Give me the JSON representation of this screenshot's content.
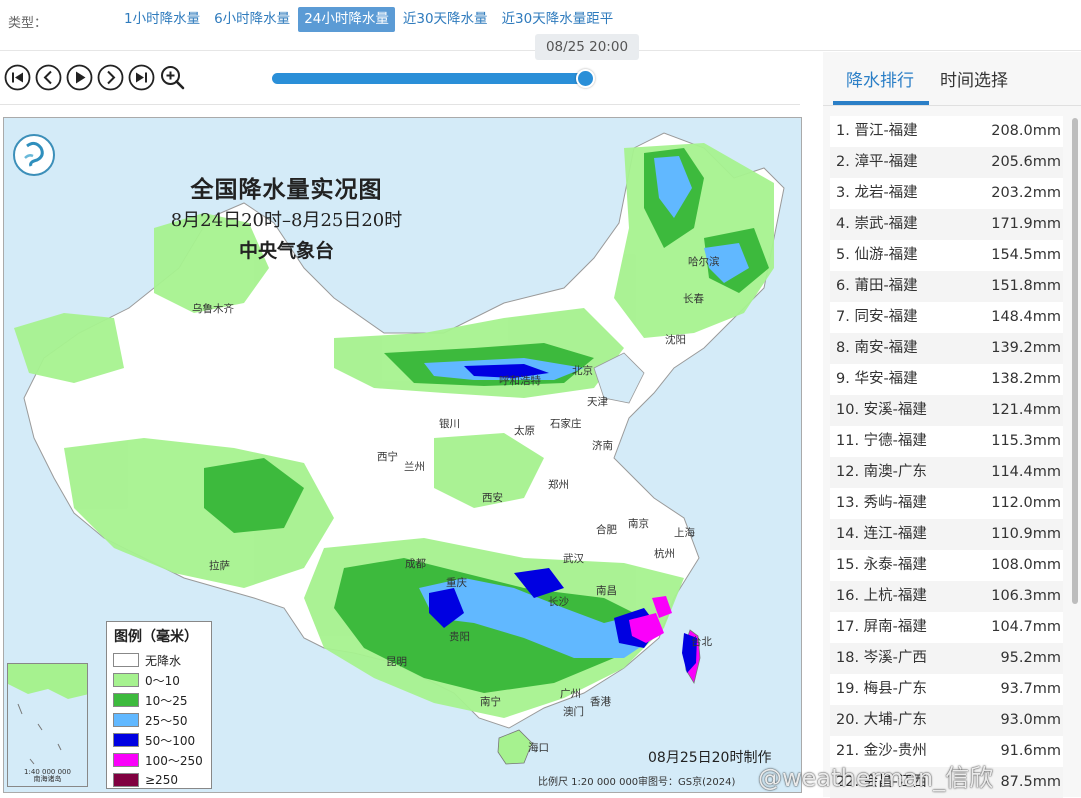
{
  "type_bar": {
    "label": "类型：",
    "tabs": [
      {
        "label": "1小时降水量",
        "active": false
      },
      {
        "label": "6小时降水量",
        "active": false
      },
      {
        "label": "24小时降水量",
        "active": true
      },
      {
        "label": "近30天降水量",
        "active": false
      },
      {
        "label": "近30天降水量距平",
        "active": false
      }
    ]
  },
  "player": {
    "controls": [
      "first-frame-icon",
      "prev-frame-icon",
      "play-icon",
      "next-frame-icon",
      "last-frame-icon",
      "zoom-in-icon"
    ],
    "current_time": "08/25 20:00",
    "progress": 1.0
  },
  "map": {
    "title": "全国降水量实况图",
    "period": "8月24日20时–8月25日20时",
    "agency": "中央气象台",
    "made_by": "08月25日20时制作",
    "scale": "比例尺 1:20 000 000",
    "review_no": "审图号：GS京(2024)",
    "legend": {
      "title": "图例（毫米）",
      "items": [
        {
          "label": "无降水",
          "color": "#ffffff"
        },
        {
          "label": "0～10",
          "color": "#a6f28f"
        },
        {
          "label": "10～25",
          "color": "#3dba3d"
        },
        {
          "label": "25～50",
          "color": "#61b8ff"
        },
        {
          "label": "50～100",
          "color": "#0000e1"
        },
        {
          "label": "100～250",
          "color": "#fa00fa"
        },
        {
          "label": "≥250",
          "color": "#800040"
        }
      ]
    },
    "inset": {
      "scale": "1:40 000 000",
      "caption": "南海诸岛"
    },
    "cities": [
      {
        "name": "哈尔滨"
      },
      {
        "name": "长春"
      },
      {
        "name": "乌鲁木齐"
      },
      {
        "name": "沈阳"
      },
      {
        "name": "呼和浩特"
      },
      {
        "name": "北京"
      },
      {
        "name": "天津"
      },
      {
        "name": "石家庄"
      },
      {
        "name": "银川"
      },
      {
        "name": "太原"
      },
      {
        "name": "济南"
      },
      {
        "name": "西宁"
      },
      {
        "name": "兰州"
      },
      {
        "name": "郑州"
      },
      {
        "name": "西安"
      },
      {
        "name": "合肥"
      },
      {
        "name": "南京"
      },
      {
        "name": "上海"
      },
      {
        "name": "武汉"
      },
      {
        "name": "杭州"
      },
      {
        "name": "拉萨"
      },
      {
        "name": "成都"
      },
      {
        "name": "重庆"
      },
      {
        "name": "长沙"
      },
      {
        "name": "南昌"
      },
      {
        "name": "台北"
      },
      {
        "name": "贵阳"
      },
      {
        "name": "昆明"
      },
      {
        "name": "广州"
      },
      {
        "name": "南宁"
      },
      {
        "name": "香港"
      },
      {
        "name": "澳门"
      },
      {
        "name": "海口"
      }
    ]
  },
  "ranking": {
    "tabs": [
      {
        "label": "降水排行",
        "active": true
      },
      {
        "label": "时间选择",
        "active": false
      }
    ],
    "items": [
      {
        "name": "1. 晋江-福建",
        "value": "208.0mm"
      },
      {
        "name": "2. 漳平-福建",
        "value": "205.6mm"
      },
      {
        "name": "3. 龙岩-福建",
        "value": "203.2mm"
      },
      {
        "name": "4. 崇武-福建",
        "value": "171.9mm"
      },
      {
        "name": "5. 仙游-福建",
        "value": "154.5mm"
      },
      {
        "name": "6. 莆田-福建",
        "value": "151.8mm"
      },
      {
        "name": "7. 同安-福建",
        "value": "148.4mm"
      },
      {
        "name": "8. 南安-福建",
        "value": "139.2mm"
      },
      {
        "name": "9. 华安-福建",
        "value": "138.2mm"
      },
      {
        "name": "10. 安溪-福建",
        "value": "121.4mm"
      },
      {
        "name": "11. 宁德-福建",
        "value": "115.3mm"
      },
      {
        "name": "12. 南澳-广东",
        "value": "114.4mm"
      },
      {
        "name": "13. 秀屿-福建",
        "value": "112.0mm"
      },
      {
        "name": "14. 连江-福建",
        "value": "110.9mm"
      },
      {
        "name": "15. 永泰-福建",
        "value": "108.0mm"
      },
      {
        "name": "16. 上杭-福建",
        "value": "106.3mm"
      },
      {
        "name": "17. 屏南-福建",
        "value": "104.7mm"
      },
      {
        "name": "18. 岑溪-广西",
        "value": "95.2mm"
      },
      {
        "name": "19. 梅县-广东",
        "value": "93.7mm"
      },
      {
        "name": "20. 大埔-广东",
        "value": "93.0mm"
      },
      {
        "name": "21. 金沙-贵州",
        "value": "91.6mm"
      },
      {
        "name": "22. 会昌-江西",
        "value": "87.5mm"
      }
    ]
  },
  "watermark": "@weatherman_信欣"
}
